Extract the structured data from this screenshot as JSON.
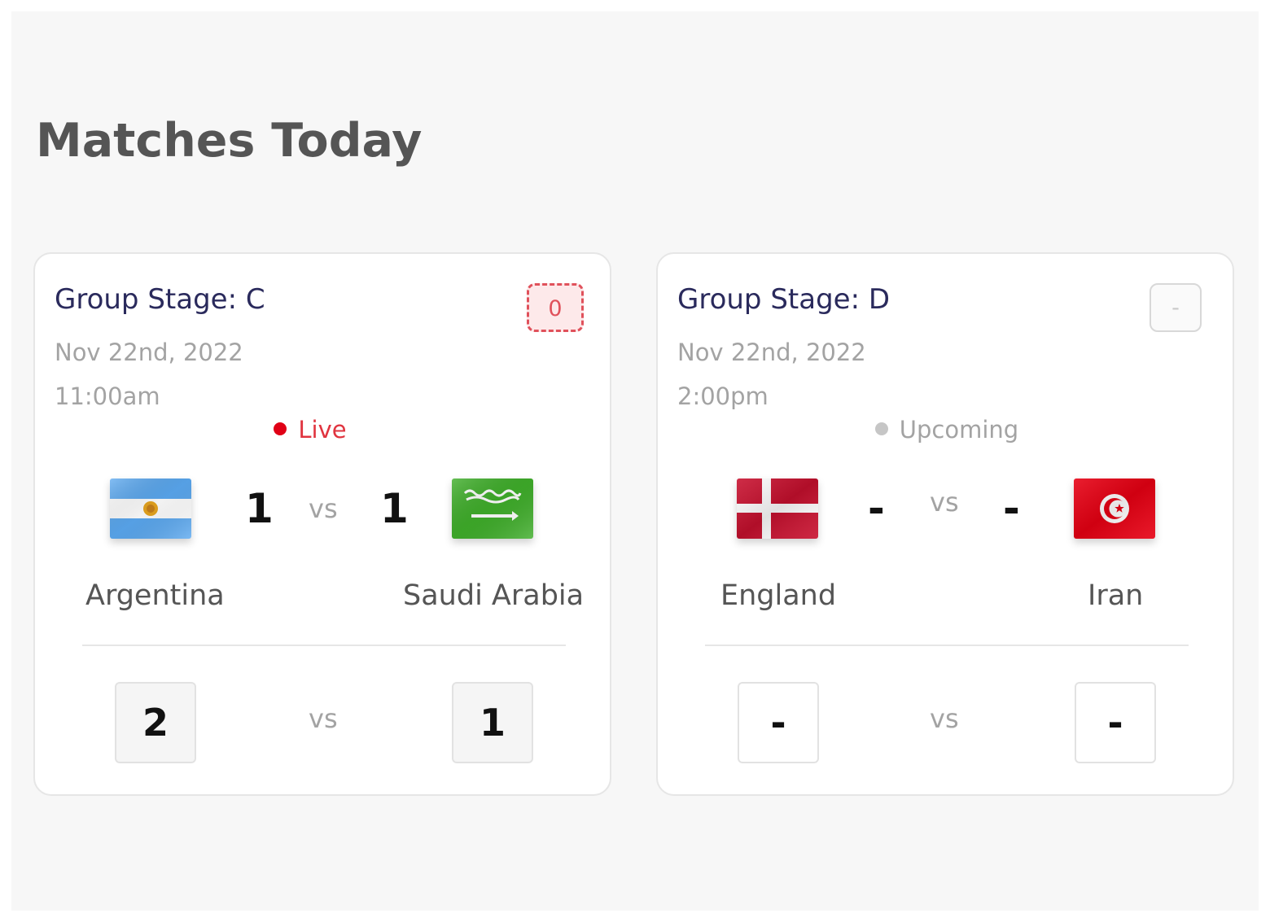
{
  "page": {
    "title": "Matches Today"
  },
  "matches": [
    {
      "stage": "Group Stage: C",
      "badge": "0",
      "date": "Nov 22nd, 2022",
      "time": "11:00am",
      "status": "Live",
      "home": {
        "name": "Argentina",
        "flag": "argentina-flag",
        "score": "1",
        "prediction": "2"
      },
      "away": {
        "name": "Saudi Arabia",
        "flag": "saudi-arabia-flag",
        "score": "1",
        "prediction": "1"
      },
      "vs": "vs"
    },
    {
      "stage": "Group Stage: D",
      "badge": "-",
      "date": "Nov 22nd, 2022",
      "time": "2:00pm",
      "status": "Upcoming",
      "home": {
        "name": "England",
        "flag": "denmark-flag",
        "score": "-",
        "prediction": "-"
      },
      "away": {
        "name": "Iran",
        "flag": "tunisia-flag",
        "score": "-",
        "prediction": "-"
      },
      "vs": "vs"
    }
  ],
  "colors": {
    "live": "#e0343f",
    "upcoming": "#a3a3a3",
    "stage_title": "#2a2a5c"
  }
}
